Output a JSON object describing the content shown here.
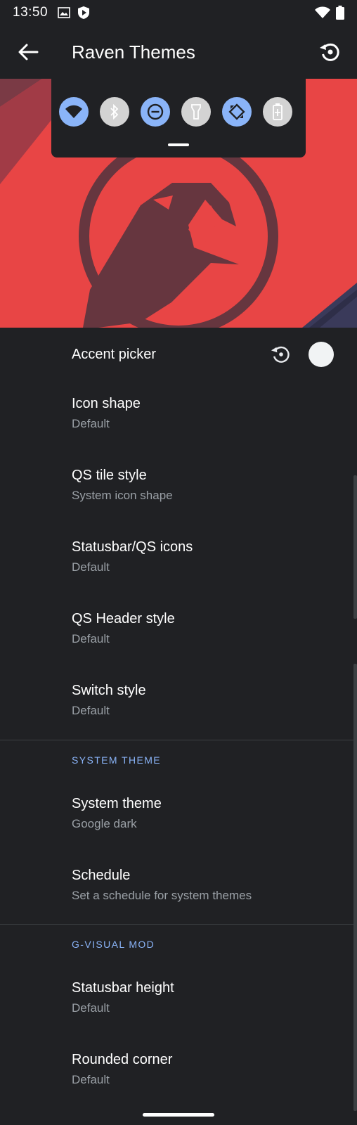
{
  "status": {
    "time": "13:50"
  },
  "appbar": {
    "title": "Raven Themes"
  },
  "colors": {
    "accent": "#8ab4f8",
    "background": "#202124",
    "hero_red": "#e84545",
    "hero_dark": "#66363f",
    "tile_off": "#d3d3d3"
  },
  "quick_settings": {
    "tiles": [
      {
        "icon": "wifi-icon",
        "state": "on"
      },
      {
        "icon": "bluetooth-icon",
        "state": "off"
      },
      {
        "icon": "do-not-disturb-icon",
        "state": "on"
      },
      {
        "icon": "flashlight-icon",
        "state": "off"
      },
      {
        "icon": "auto-rotate-icon",
        "state": "on"
      },
      {
        "icon": "battery-saver-icon",
        "state": "off"
      }
    ]
  },
  "accent": {
    "label": "Accent picker",
    "swatch_color": "#f1f3f4"
  },
  "prefs_group1": [
    {
      "title": "Icon shape",
      "summary": "Default"
    },
    {
      "title": "QS tile style",
      "summary": "System icon shape"
    },
    {
      "title": "Statusbar/QS icons",
      "summary": "Default"
    },
    {
      "title": "QS Header style",
      "summary": "Default"
    },
    {
      "title": "Switch style",
      "summary": "Default"
    }
  ],
  "section_system": {
    "header": "SYSTEM THEME",
    "items": [
      {
        "title": "System theme",
        "summary": "Google dark"
      },
      {
        "title": "Schedule",
        "summary": "Set a schedule for system themes"
      }
    ]
  },
  "section_gvisual": {
    "header": "G-VISUAL MOD",
    "items": [
      {
        "title": "Statusbar height",
        "summary": "Default"
      },
      {
        "title": "Rounded corner",
        "summary": "Default"
      }
    ]
  }
}
